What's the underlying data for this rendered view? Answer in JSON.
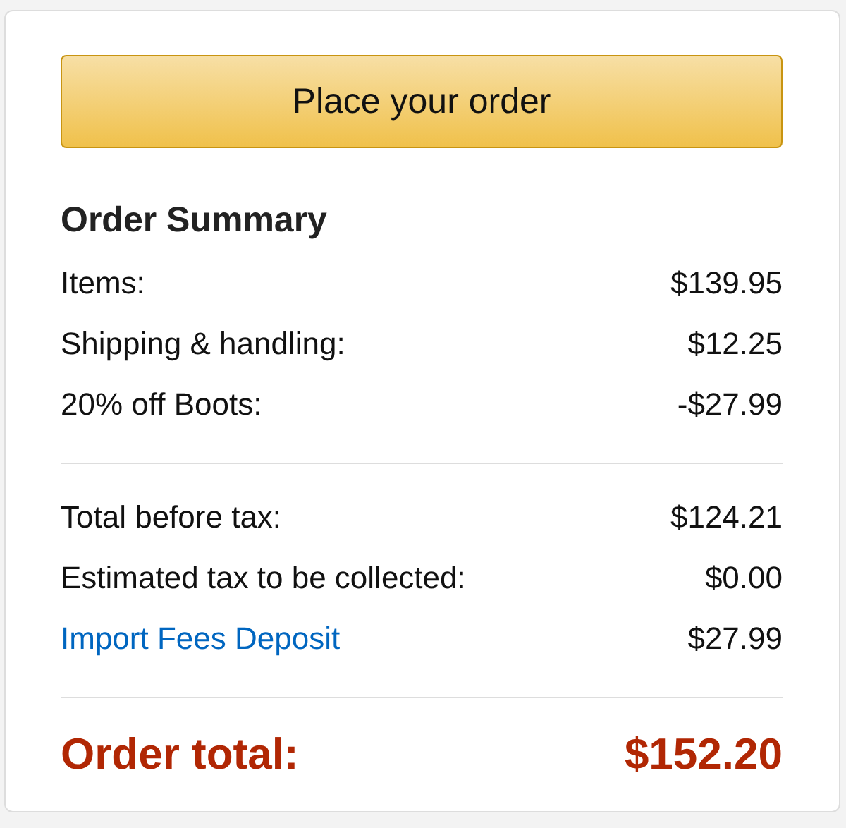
{
  "button": {
    "label": "Place your order"
  },
  "summary": {
    "title": "Order Summary",
    "groups": [
      [
        {
          "kind": "text",
          "label": "Items:",
          "amount": "$139.95"
        },
        {
          "kind": "text",
          "label": "Shipping & handling:",
          "amount": "$12.25"
        },
        {
          "kind": "text",
          "label": "20% off Boots:",
          "amount": "-$27.99"
        }
      ],
      [
        {
          "kind": "text",
          "label": "Total before tax:",
          "amount": "$124.21"
        },
        {
          "kind": "text",
          "label": "Estimated tax to be collected:",
          "amount": "$0.00"
        },
        {
          "kind": "link",
          "label": "Import Fees Deposit",
          "amount": "$27.99"
        }
      ]
    ],
    "total": {
      "label": "Order total:",
      "amount": "$152.20"
    }
  }
}
